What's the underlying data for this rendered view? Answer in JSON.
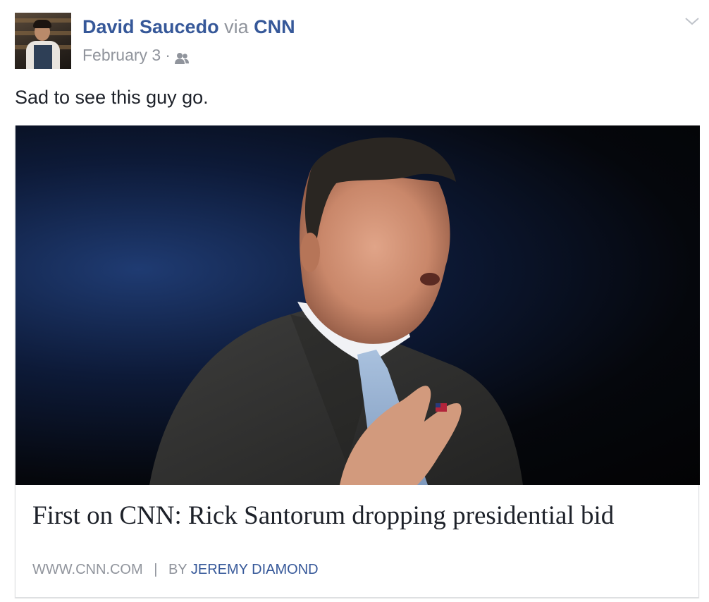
{
  "post": {
    "author": "David Saucedo",
    "via_label": "via",
    "source": "CNN",
    "date": "February 3",
    "separator": "·",
    "audience_icon": "friends-icon",
    "message": "Sad to see this guy go."
  },
  "link_card": {
    "title": "First on CNN: Rick Santorum dropping presidential bid",
    "domain": "WWW.CNN.COM",
    "divider": "|",
    "by_label": "BY",
    "author": "JEREMY DIAMOND"
  },
  "colors": {
    "link_blue": "#365899",
    "meta_gray": "#90949c",
    "text": "#1d2129"
  }
}
